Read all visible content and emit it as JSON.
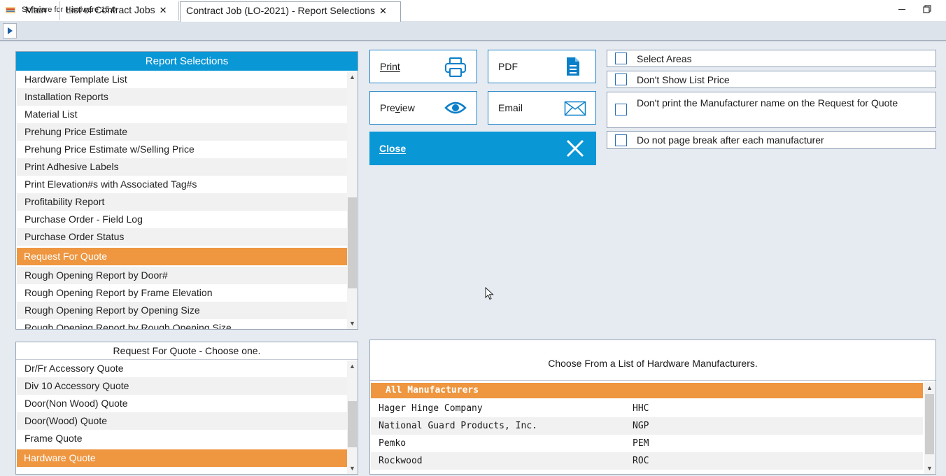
{
  "window": {
    "title": "Software for Hardware 15.0"
  },
  "tabs": [
    {
      "label": "Main"
    },
    {
      "label": "List of Contract Jobs",
      "close": "✕"
    },
    {
      "label": "Contract Job (LO-2021) - Report Selections",
      "close": "✕"
    }
  ],
  "report_panel": {
    "header": "Report Selections",
    "items": [
      "Hardware Template List",
      "Installation Reports",
      "Material List",
      "Prehung Price Estimate",
      "Prehung Price Estimate w/Selling Price",
      "Print Adhesive Labels",
      "Print Elevation#s with Associated Tag#s",
      "Profitability Report",
      "Purchase Order - Field Log",
      "Purchase Order Status",
      "Request For Quote",
      "Rough Opening Report by Door#",
      "Rough Opening Report by Frame Elevation",
      "Rough Opening Report by Opening Size",
      "Rough Opening Report by Rough Opening Size"
    ],
    "selected": "Request For Quote"
  },
  "quote_panel": {
    "header": "Request For Quote - Choose one.",
    "items": [
      "Dr/Fr Accessory Quote",
      "Div 10 Accessory Quote",
      "Door(Non Wood) Quote",
      "Door(Wood) Quote",
      "Frame Quote",
      "Hardware Quote"
    ],
    "selected": "Hardware Quote"
  },
  "actions": {
    "print": "Print",
    "pdf": "PDF",
    "preview": "Preview",
    "email": "Email",
    "close": "Close"
  },
  "options": [
    {
      "label": "Select Areas",
      "checked": false
    },
    {
      "label": "Don't Show List Price",
      "checked": false
    },
    {
      "label": "Don't print the Manufacturer name on the Request for Quote",
      "checked": false
    },
    {
      "label": "Do not page break after each manufacturer",
      "checked": false
    }
  ],
  "manufacturers": {
    "header": "Choose From a List of Hardware Manufacturers.",
    "all_label": "All Manufacturers",
    "rows": [
      {
        "name": "Hager Hinge Company",
        "code": "HHC"
      },
      {
        "name": "National Guard Products, Inc.",
        "code": "NGP"
      },
      {
        "name": "Pemko",
        "code": "PEM"
      },
      {
        "name": "Rockwood",
        "code": "ROC"
      }
    ]
  },
  "colors": {
    "accent_blue": "#0a97d6",
    "selection_orange": "#ee9640",
    "background": "#e6ebf2"
  }
}
